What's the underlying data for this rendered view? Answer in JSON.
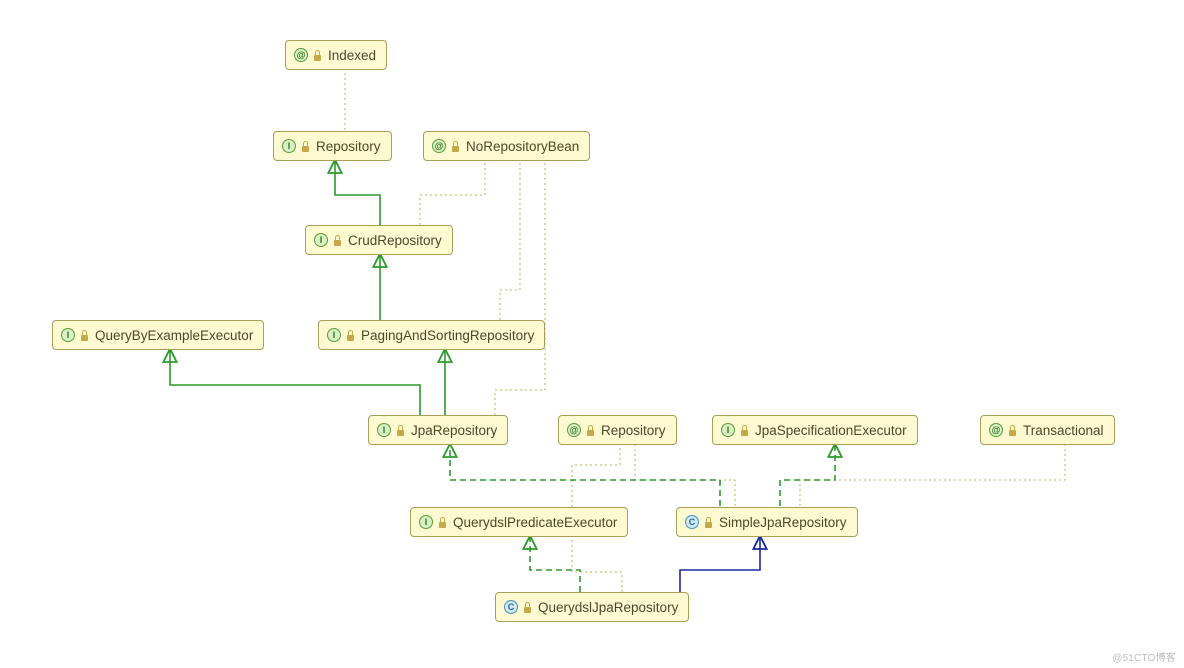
{
  "nodes": {
    "indexed": {
      "type": "annotation",
      "label": "Indexed"
    },
    "repo": {
      "type": "interface",
      "label": "Repository"
    },
    "norepobean": {
      "type": "annotation",
      "label": "NoRepositoryBean"
    },
    "crudrepo": {
      "type": "interface",
      "label": "CrudRepository"
    },
    "qbee": {
      "type": "interface",
      "label": "QueryByExampleExecutor"
    },
    "pagsort": {
      "type": "interface",
      "label": "PagingAndSortingRepository"
    },
    "jparepo": {
      "type": "interface",
      "label": "JpaRepository"
    },
    "repo_anno": {
      "type": "annotation",
      "label": "Repository"
    },
    "jpaspec": {
      "type": "interface",
      "label": "JpaSpecificationExecutor"
    },
    "transactional": {
      "type": "annotation",
      "label": "Transactional"
    },
    "qdslpred": {
      "type": "interface",
      "label": "QuerydslPredicateExecutor"
    },
    "simplejpa": {
      "type": "class",
      "label": "SimpleJpaRepository"
    },
    "qdsljparepo": {
      "type": "class",
      "label": "QuerydslJpaRepository"
    }
  },
  "watermark": "@51CTO博客"
}
